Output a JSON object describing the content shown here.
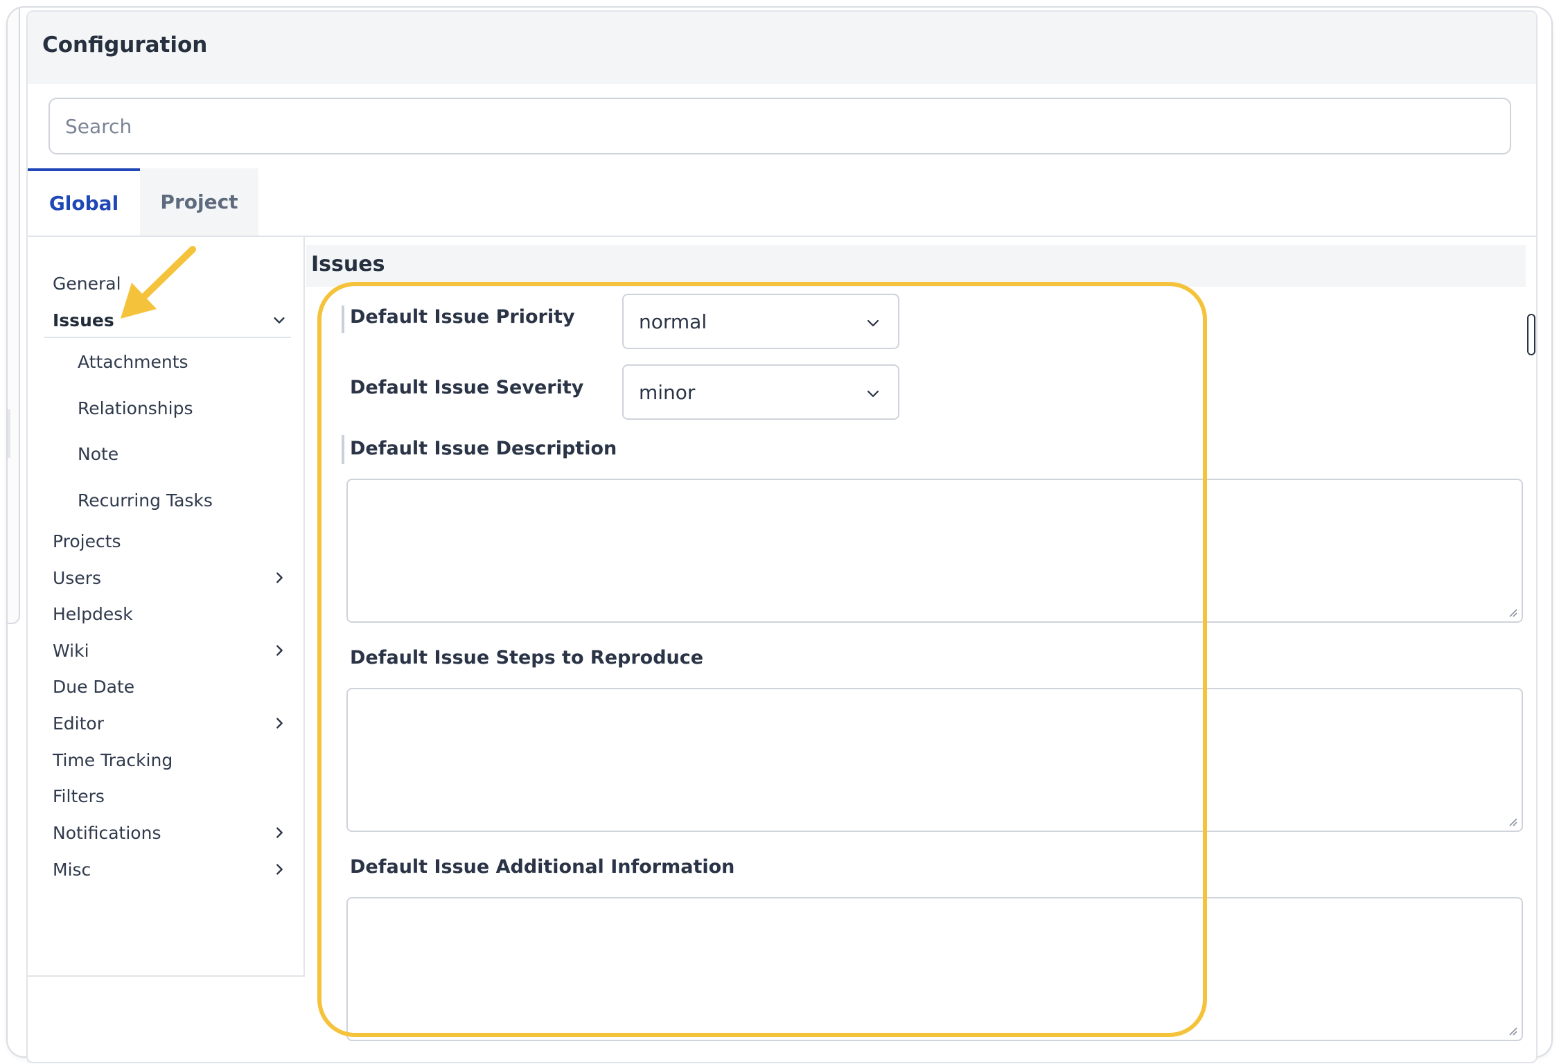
{
  "header": {
    "title": "Configuration"
  },
  "search": {
    "placeholder": "Search"
  },
  "tabs": [
    {
      "label": "Global",
      "active": true
    },
    {
      "label": "Project",
      "active": false
    }
  ],
  "sidebar": {
    "items": [
      {
        "label": "General"
      },
      {
        "label": "Issues",
        "expanded": true,
        "icon": "chevron-down-icon"
      },
      {
        "label": "Attachments"
      },
      {
        "label": "Relationships"
      },
      {
        "label": "Note"
      },
      {
        "label": "Recurring Tasks"
      },
      {
        "label": "Projects"
      },
      {
        "label": "Users",
        "icon": "chevron-right-icon"
      },
      {
        "label": "Helpdesk"
      },
      {
        "label": "Wiki",
        "icon": "chevron-right-icon"
      },
      {
        "label": "Due Date"
      },
      {
        "label": "Editor",
        "icon": "chevron-right-icon"
      },
      {
        "label": "Time Tracking"
      },
      {
        "label": "Filters"
      },
      {
        "label": "Notifications",
        "icon": "chevron-right-icon"
      },
      {
        "label": "Misc",
        "icon": "chevron-right-icon"
      }
    ]
  },
  "content": {
    "title": "Issues",
    "fields": {
      "priority": {
        "label": "Default Issue Priority",
        "value": "normal"
      },
      "severity": {
        "label": "Default Issue Severity",
        "value": "minor"
      },
      "description": {
        "label": "Default Issue Description",
        "value": ""
      },
      "steps": {
        "label": "Default Issue Steps to Reproduce",
        "value": ""
      },
      "additional": {
        "label": "Default Issue Additional Information",
        "value": ""
      }
    }
  },
  "colors": {
    "accent": "#1f47b6",
    "highlight": "#f5c33b",
    "text": "#2a3446",
    "border": "#cfd3da"
  }
}
